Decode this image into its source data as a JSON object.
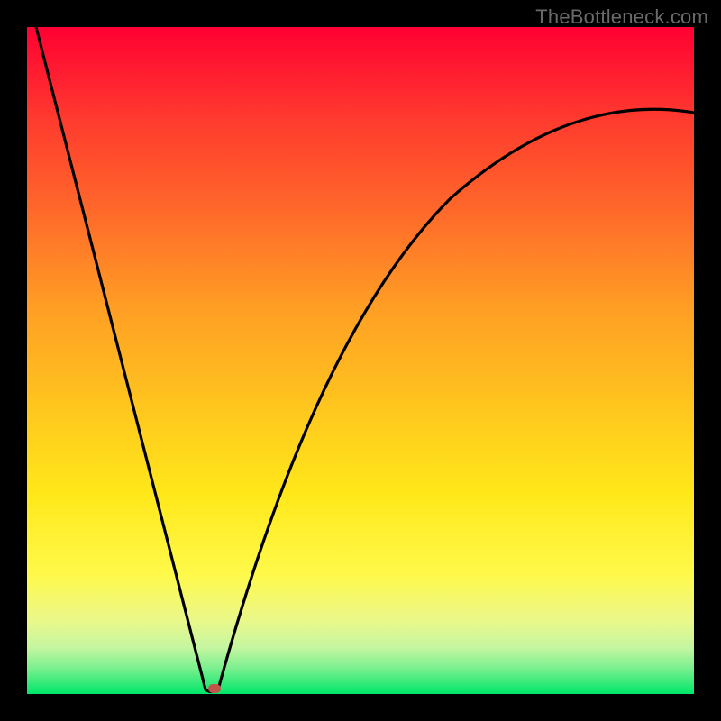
{
  "attribution": "TheBottleneck.com",
  "colors": {
    "frame": "#000000",
    "marker": "#c0564a",
    "curve": "#000000"
  },
  "chart_data": {
    "type": "line",
    "title": "",
    "xlabel": "",
    "ylabel": "",
    "xlim": [
      0,
      100
    ],
    "ylim": [
      0,
      100
    ],
    "grid": false,
    "legend": false,
    "annotations": [
      "TheBottleneck.com"
    ],
    "series": [
      {
        "name": "left-branch",
        "x": [
          0,
          5,
          10,
          15,
          20,
          25,
          27
        ],
        "y": [
          100,
          81,
          63,
          44,
          26,
          7,
          0
        ]
      },
      {
        "name": "right-branch",
        "x": [
          27,
          29,
          32,
          36,
          40,
          45,
          50,
          55,
          60,
          65,
          70,
          75,
          80,
          85,
          90,
          95,
          100
        ],
        "y": [
          0,
          11,
          24,
          37,
          47,
          56,
          63,
          68,
          72,
          75,
          78,
          80,
          82,
          84,
          85,
          86,
          87
        ]
      }
    ],
    "marker": {
      "x": 28,
      "y": 0
    }
  }
}
